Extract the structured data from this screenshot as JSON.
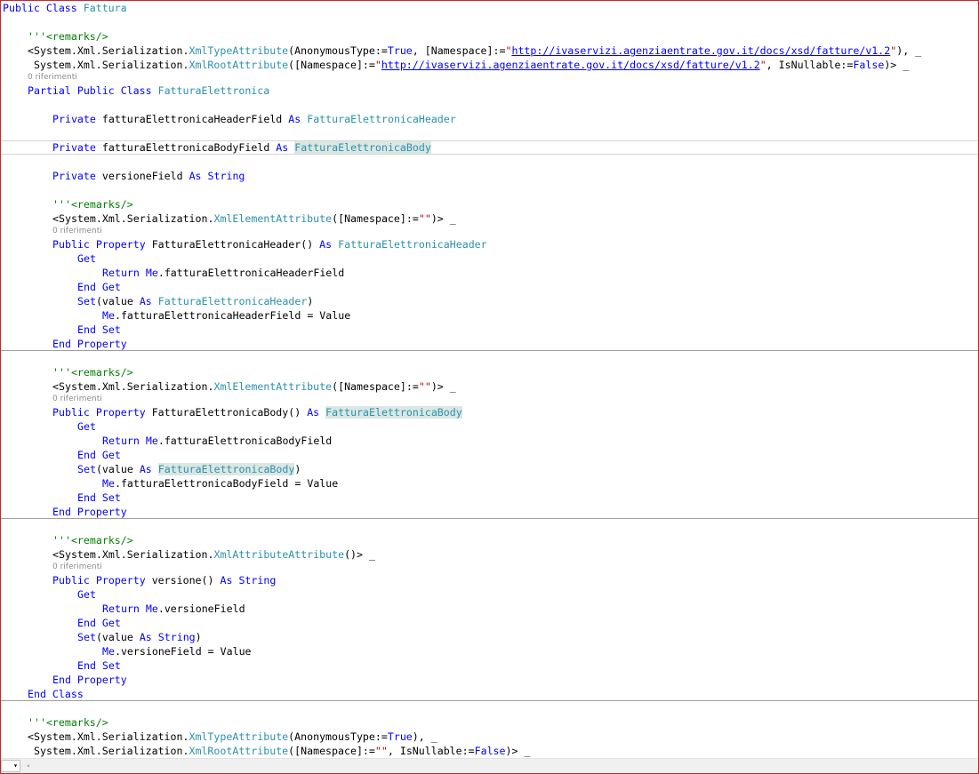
{
  "editor": {
    "lens": "0 riferimenti",
    "line_outer_class": [
      "Public Class ",
      "Fattura"
    ],
    "line_remarks": "'''<remarks/>",
    "l1": [
      "<System.Xml.Serialization.",
      "XmlTypeAttribute",
      "(AnonymousType:=",
      "True",
      ", [Namespace]:=",
      "\"",
      "http://ivaservizi.agenziaentrate.gov.it/docs/xsd/fatture/v1.2",
      "\"",
      "), _"
    ],
    "l2": [
      " System.Xml.Serialization.",
      "XmlRootAttribute",
      "([Namespace]:=",
      "\"",
      "http://ivaservizi.agenziaentrate.gov.it/docs/xsd/fatture/v1.2",
      "\"",
      ", IsNullable:=",
      "False",
      ")> _"
    ],
    "l3": [
      "Partial Public Class ",
      "FatturaElettronica"
    ],
    "l4": [
      "Private",
      " fatturaElettronicaHeaderField ",
      "As",
      " ",
      "FatturaElettronicaHeader"
    ],
    "l5": [
      "Private",
      " fatturaElettronicaBodyField ",
      "As",
      " ",
      "FatturaElettronicaBody"
    ],
    "l6": [
      "Private",
      " versioneField ",
      "As",
      " ",
      "String"
    ],
    "l8": [
      "<System.Xml.Serialization.",
      "XmlElementAttribute",
      "([Namespace]:=",
      "\"\"",
      ")> _"
    ],
    "l9": [
      "Public",
      " ",
      "Property",
      " FatturaElettronicaHeader() ",
      "As",
      " ",
      "FatturaElettronicaHeader"
    ],
    "get": "Get",
    "return_kw": "Return",
    "me_kw": "Me",
    "l11": ".fatturaElettronicaHeaderField",
    "end_get": "End Get",
    "l13": [
      "Set",
      "(value ",
      "As",
      " ",
      "FatturaElettronicaHeader",
      ")"
    ],
    "l14": ".fatturaElettronicaHeaderField = Value",
    "end_set": "End Set",
    "end_property": "End Property",
    "l18": [
      "<System.Xml.Serialization.",
      "XmlElementAttribute",
      "([Namespace]:=",
      "\"\"",
      ")> _"
    ],
    "l19": [
      "Public",
      " ",
      "Property",
      " FatturaElettronicaBody() ",
      "As",
      " ",
      "FatturaElettronicaBody"
    ],
    "l21": ".fatturaElettronicaBodyField",
    "l23": [
      "Set",
      "(value ",
      "As",
      " ",
      "FatturaElettronicaBody",
      ")"
    ],
    "l24": ".fatturaElettronicaBodyField = Value",
    "l28": [
      "<System.Xml.Serialization.",
      "XmlAttributeAttribute",
      "()> _"
    ],
    "l29": [
      "Public",
      " ",
      "Property",
      " versione() ",
      "As",
      " ",
      "String"
    ],
    "l31": ".versioneField",
    "l33": [
      "Set",
      "(value ",
      "As",
      " ",
      "String",
      ")"
    ],
    "l34": ".versioneField = Value",
    "end_class": "End Class",
    "l38": [
      "<System.Xml.Serialization.",
      "XmlTypeAttribute",
      "(AnonymousType:=",
      "True",
      "), _"
    ],
    "l39": [
      " System.Xml.Serialization.",
      "XmlRootAttribute",
      "([Namespace]:=",
      "\"\"",
      ", IsNullable:=",
      "False",
      ")> _"
    ]
  },
  "statusbar": {
    "zoom_arrow": "▾",
    "scroll_left": "◂"
  },
  "colors": {
    "keyword": "#0000ff",
    "type": "#2b91af",
    "comment": "#008000",
    "xmldoc": "#808080",
    "string": "#a31515",
    "highlight": "#dbe7e2",
    "border": "#c8272e"
  }
}
